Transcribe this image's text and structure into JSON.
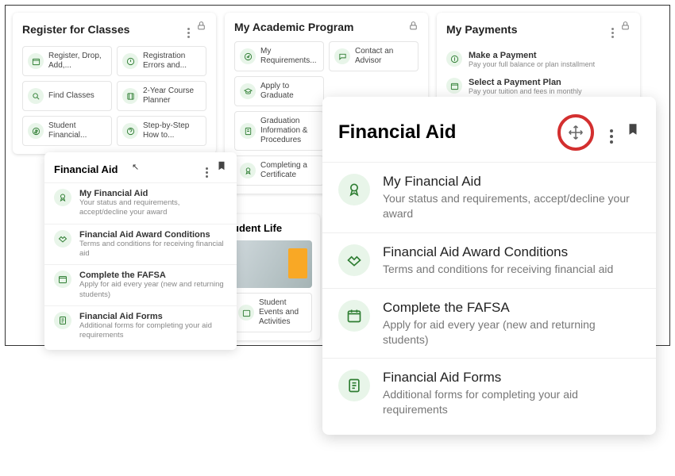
{
  "cards": {
    "register": {
      "title": "Register for Classes",
      "tiles": [
        {
          "label": "Register, Drop, Add,...",
          "icon": "calendar-icon"
        },
        {
          "label": "Registration Errors and...",
          "icon": "alert-icon"
        },
        {
          "label": "Find Classes",
          "icon": "search-icon"
        },
        {
          "label": "2-Year Course Planner",
          "icon": "planner-icon"
        },
        {
          "label": "Student Financial...",
          "icon": "dollar-icon"
        },
        {
          "label": "Step-by-Step How to...",
          "icon": "help-icon"
        }
      ]
    },
    "academic": {
      "title": "My Academic Program",
      "tiles": [
        {
          "label": "My Requirements...",
          "icon": "compass-icon"
        },
        {
          "label": "Contact an Advisor",
          "icon": "chat-icon"
        },
        {
          "label": "Apply to Graduate",
          "icon": "grad-icon"
        },
        {
          "label": "",
          "icon": ""
        },
        {
          "label": "Graduation Information & Procedures",
          "icon": "doc-icon"
        },
        {
          "label": "",
          "icon": ""
        },
        {
          "label": "Completing a Certificate",
          "icon": "cert-icon"
        }
      ]
    },
    "payments": {
      "title": "My Payments",
      "items": [
        {
          "title": "Make a Payment",
          "desc": "Pay your full balance or plan installment",
          "icon": "dollar-icon"
        },
        {
          "title": "Select a Payment Plan",
          "desc": "Pay your tuition and fees in monthly",
          "icon": "calendar-icon"
        }
      ]
    },
    "studentlife": {
      "title": "udent Life",
      "link": "Student Events and Activities"
    }
  },
  "financial_aid": {
    "title_small": "Financial Aid",
    "title_large": "Financial Aid",
    "items": [
      {
        "title": "My Financial Aid",
        "desc": "Your status and requirements, accept/decline your award",
        "icon": "award-icon"
      },
      {
        "title": "Financial Aid Award Conditions",
        "desc": "Terms and conditions for receiving financial aid",
        "icon": "handshake-icon"
      },
      {
        "title": "Complete the FAFSA",
        "desc": "Apply for aid every year (new and returning students)",
        "icon": "calendar-icon"
      },
      {
        "title": "Financial Aid Forms",
        "desc": "Additional forms for completing your aid requirements",
        "icon": "form-icon"
      }
    ]
  },
  "icons": {
    "more": "⋮",
    "lock": "🔒",
    "bookmark": "🔖"
  },
  "colors": {
    "accent": "#2e7d32",
    "ring": "#d32f2f",
    "iconBg": "#e8f5e9"
  }
}
